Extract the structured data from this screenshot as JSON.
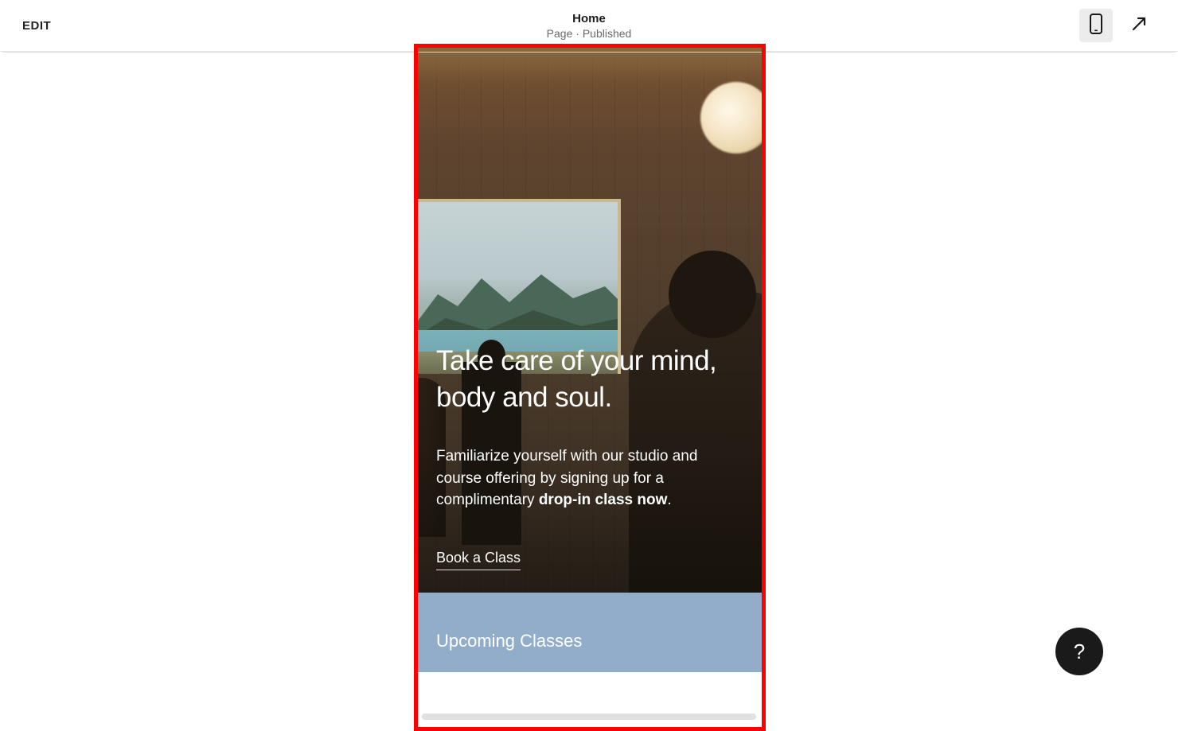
{
  "toolbar": {
    "edit_label": "EDIT",
    "page_title": "Home",
    "page_meta": "Page · Published"
  },
  "preview": {
    "hero": {
      "heading": "Take care of your mind, body and soul.",
      "description_prefix": "Familiarize yourself with our studio and course offering by signing up for a complimentary ",
      "description_bold": "drop-in class now",
      "description_suffix": ".",
      "cta_label": "Book a Class"
    },
    "upcoming": {
      "heading": "Upcoming Classes"
    }
  },
  "icons": {
    "mobile": "mobile-icon",
    "expand": "expand-icon",
    "help": "?"
  },
  "colors": {
    "highlight": "#ff0000",
    "upcoming_bg": "#91adc9"
  }
}
